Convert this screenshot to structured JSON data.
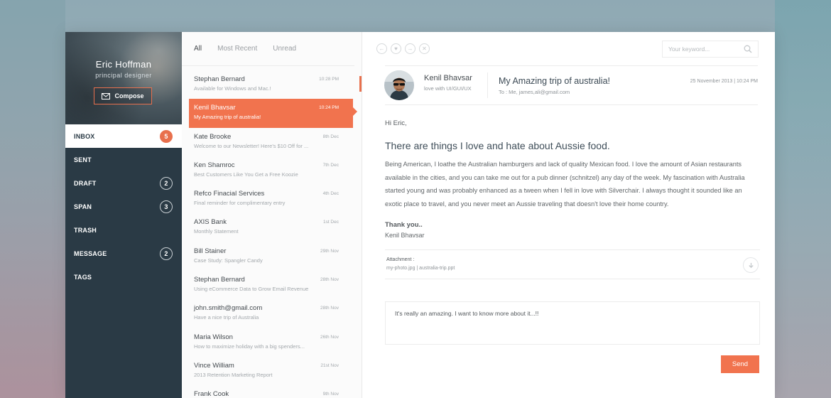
{
  "profile": {
    "name": "Eric Hoffman",
    "role": "principal designer",
    "compose_label": "Compose"
  },
  "nav": [
    {
      "label": "INBOX",
      "count": "5",
      "active": true
    },
    {
      "label": "SENT",
      "count": ""
    },
    {
      "label": "DRAFT",
      "count": "2"
    },
    {
      "label": "SPAN",
      "count": "3"
    },
    {
      "label": "TRASH",
      "count": ""
    },
    {
      "label": "MESSAGE",
      "count": "2"
    },
    {
      "label": "TAGS",
      "count": ""
    }
  ],
  "tabs": [
    {
      "label": "All",
      "active": true
    },
    {
      "label": "Most Recent"
    },
    {
      "label": "Unread"
    }
  ],
  "mails": [
    {
      "from": "Stephan Bernard",
      "subject": "Available for Windows and Mac.!",
      "date": "10:28 PM"
    },
    {
      "from": "Kenil Bhavsar",
      "subject": "My Amazing trip of australia!",
      "date": "10:24 PM",
      "selected": true
    },
    {
      "from": "Kate Brooke",
      "subject": "Welcome to our Newsletter! Here's $10 Off for ...",
      "date": "8th Dec"
    },
    {
      "from": "Ken Shamroc",
      "subject": "Best Customers Like You Get a Free Koozie",
      "date": "7th Dec"
    },
    {
      "from": "Refco Finacial Services",
      "subject": "Final reminder for complimentary entry",
      "date": "4th Dec"
    },
    {
      "from": "AXIS Bank",
      "subject": "Monthly Statement",
      "date": "1st Dec"
    },
    {
      "from": "Bill Stainer",
      "subject": "Case Study: Spangler Candy",
      "date": "29th Nov"
    },
    {
      "from": "Stephan Bernard",
      "subject": "Using eCommerce Data to Grow Email Revenue",
      "date": "28th Nov"
    },
    {
      "from": "john.smith@gmail.com",
      "subject": "Have a nice trip of  Australia",
      "date": "28th Nov"
    },
    {
      "from": "Maria Wilson",
      "subject": "How to maximize holiday  with a big spenders...",
      "date": "26th Nov"
    },
    {
      "from": "Vince William",
      "subject": "2013 Retention Marketing Report",
      "date": "21st Nov"
    },
    {
      "from": "Frank Cook",
      "subject": "",
      "date": "9th Nov"
    }
  ],
  "search": {
    "placeholder": "Your keyword..."
  },
  "message": {
    "sender_name": "Kenil Bhavsar",
    "sender_role": "love with UI/GUI/UX",
    "subject": "My Amazing trip of australia!",
    "to": "To : Me, james,ali@gmail.com",
    "date": "25 November 2013 | 10:24 PM",
    "greeting": "Hi Eric,",
    "headline": "There are things I love and hate about Aussie food.",
    "body": "Being American, I loathe the Australian hamburgers and lack of quality Mexican food. I love the amount of Asian restaurants available in the cities, and you can take me out for a pub dinner (schnitzel) any day of the week.  My fascination with Australia started young and was probably enhanced as a tween when I fell in love with Silverchair. I always thought it sounded like an exotic place to travel, and you never meet an Aussie traveling that doesn't love their home country.",
    "thanks": "Thank you..",
    "signature": "Kenil Bhavsar",
    "attachment_label": "Attachment :",
    "attachment_files": "my-photo.jpg  |  australia-trip.ppt"
  },
  "reply": {
    "text": "It's  really  an amazing. I want to know more about it...!!",
    "send_label": "Send"
  },
  "colors": {
    "accent": "#f1734e",
    "sidebar": "#2a3a45"
  }
}
